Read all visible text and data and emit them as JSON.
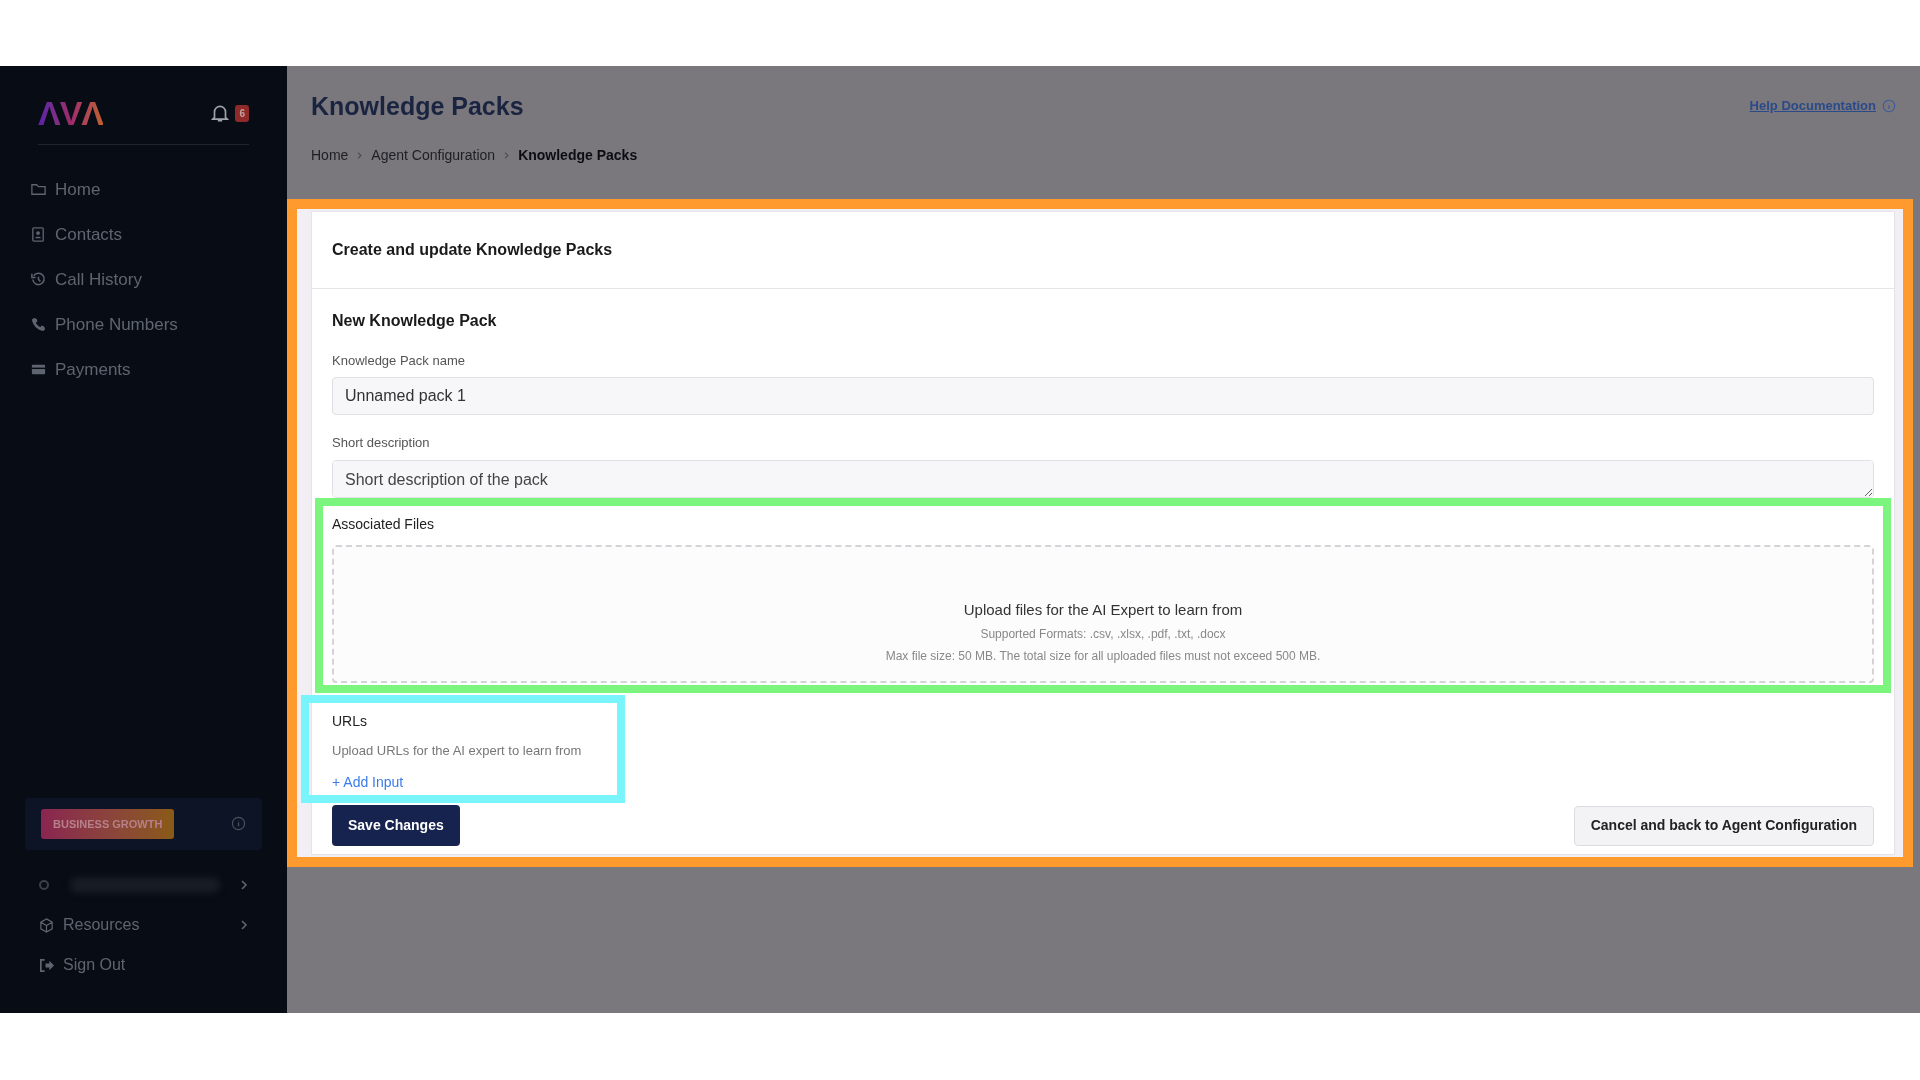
{
  "sidebar": {
    "logo": "ΛVΛ",
    "notifications": "6",
    "nav": [
      {
        "label": "Home"
      },
      {
        "label": "Contacts"
      },
      {
        "label": "Call History"
      },
      {
        "label": "Phone Numbers"
      },
      {
        "label": "Payments"
      }
    ],
    "plan_badge": "BUSINESS GROWTH",
    "bottom": [
      {
        "label": "Resources",
        "expandable": true
      },
      {
        "label": "Sign Out",
        "expandable": false
      }
    ]
  },
  "header": {
    "title": "Knowledge Packs",
    "help_link": "Help Documentation",
    "breadcrumbs": [
      {
        "label": "Home",
        "selected": false
      },
      {
        "label": "Agent Configuration",
        "selected": false
      },
      {
        "label": "Knowledge Packs",
        "selected": true
      }
    ]
  },
  "card": {
    "title": "Create and update Knowledge Packs",
    "section": "New Knowledge Pack",
    "name_field": {
      "label": "Knowledge Pack name",
      "value": "Unnamed pack 1"
    },
    "description_field": {
      "label": "Short description",
      "placeholder": "Short description of the pack"
    },
    "files": {
      "label": "Associated Files",
      "prompt": "Upload files for the AI Expert to learn from",
      "formats": "Supported Formats: .csv, .xlsx, .pdf, .txt, .docx",
      "limits": "Max file size: 50 MB. The total size for all uploaded files must not exceed 500 MB."
    },
    "urls": {
      "label": "URLs",
      "hint": "Upload URLs for the AI expert to learn from",
      "add": "+ Add Input"
    },
    "save": "Save Changes",
    "cancel": "Cancel and back to Agent Configuration"
  }
}
